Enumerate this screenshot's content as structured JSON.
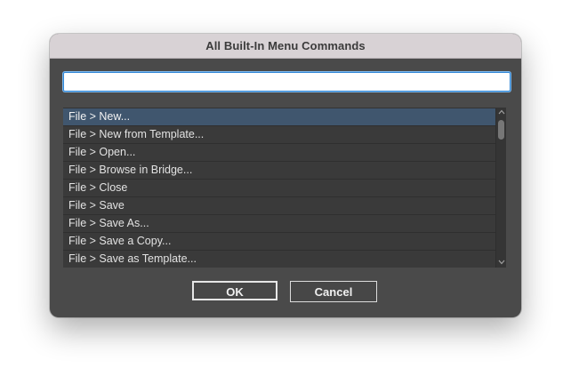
{
  "dialog": {
    "title": "All Built-In Menu Commands"
  },
  "search": {
    "value": "",
    "placeholder": ""
  },
  "commands": [
    {
      "label": "File > New...",
      "selected": true
    },
    {
      "label": "File > New from Template...",
      "selected": false
    },
    {
      "label": "File > Open...",
      "selected": false
    },
    {
      "label": "File > Browse in Bridge...",
      "selected": false
    },
    {
      "label": "File > Close",
      "selected": false
    },
    {
      "label": "File > Save",
      "selected": false
    },
    {
      "label": "File > Save As...",
      "selected": false
    },
    {
      "label": "File > Save a Copy...",
      "selected": false
    },
    {
      "label": "File > Save as Template...",
      "selected": false
    }
  ],
  "scrollbar": {
    "up_icon": "chevron-up-icon",
    "down_icon": "chevron-down-icon"
  },
  "buttons": {
    "ok_label": "OK",
    "cancel_label": "Cancel"
  },
  "colors": {
    "dialog_background": "#4a4a4a",
    "titlebar_background": "#d8d2d5",
    "selected_row": "#40566e",
    "focus_ring": "#2f86d6"
  }
}
